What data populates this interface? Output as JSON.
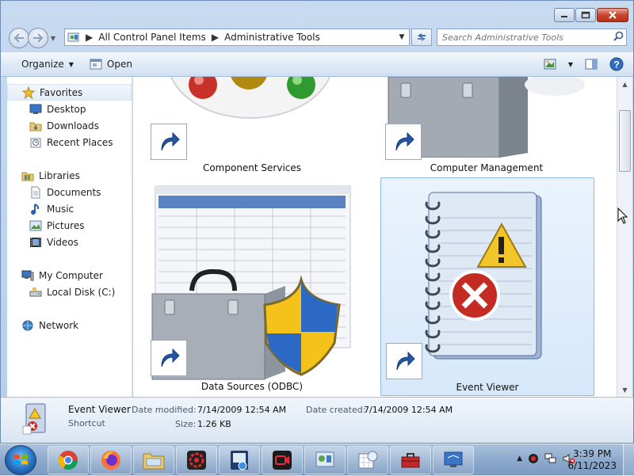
{
  "window": {
    "caption_buttons": [
      "minimize",
      "maximize",
      "close"
    ]
  },
  "address_bar": {
    "breadcrumbs": [
      "All Control Panel Items",
      "Administrative Tools"
    ]
  },
  "search": {
    "placeholder": "Search Administrative Tools"
  },
  "toolbar": {
    "organize_label": "Organize",
    "open_label": "Open"
  },
  "nav": {
    "favorites": {
      "label": "Favorites",
      "items": [
        {
          "label": "Desktop"
        },
        {
          "label": "Downloads"
        },
        {
          "label": "Recent Places"
        }
      ]
    },
    "libraries": {
      "label": "Libraries",
      "items": [
        {
          "label": "Documents"
        },
        {
          "label": "Music"
        },
        {
          "label": "Pictures"
        },
        {
          "label": "Videos"
        }
      ]
    },
    "computer": {
      "label": "My Computer",
      "items": [
        {
          "label": "Local Disk (C:)"
        }
      ]
    },
    "network": {
      "label": "Network"
    }
  },
  "content": {
    "items": [
      {
        "label": "Component Services"
      },
      {
        "label": "Computer Management"
      },
      {
        "label": "Data Sources (ODBC)"
      },
      {
        "label": "Event Viewer"
      }
    ]
  },
  "details": {
    "name": "Event Viewer",
    "type": "Shortcut",
    "date_modified_label": "Date modified:",
    "date_modified": "7/14/2009 12:54 AM",
    "date_created_label": "Date created:",
    "date_created": "7/14/2009 12:54 AM",
    "size_label": "Size:",
    "size": "1.26 KB"
  },
  "taskbar": {
    "apps": [
      "chrome-icon",
      "firefox-icon",
      "explorer-icon",
      "app-red-gear-icon",
      "app-image-icon",
      "app-recorder-icon",
      "control-panel-icon",
      "calendar-clock-icon",
      "toolbox-icon",
      "remote-desktop-icon"
    ],
    "time": "3:39 PM",
    "date": "6/11/2023"
  },
  "colors": {
    "selection": "#d6e8fa",
    "taskbar": "#8eaacc",
    "close_button": "#c8452e"
  }
}
